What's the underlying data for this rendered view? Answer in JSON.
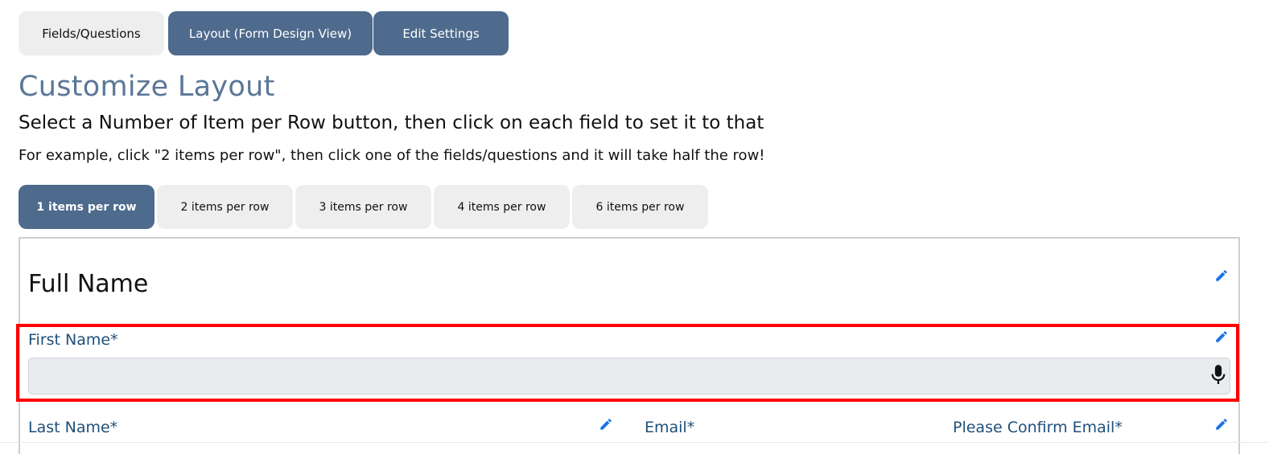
{
  "tabs": [
    {
      "label": "Fields/Questions",
      "active": false
    },
    {
      "label": "Layout (Form Design View)",
      "active": true
    },
    {
      "label": "Edit Settings",
      "active": false
    }
  ],
  "page": {
    "title": "Customize Layout",
    "subtitle": "Select a Number of Item per Row button, then click on each field to set it to that",
    "example": "For example, click \"2 items per row\", then click one of the fields/questions and it will take half the row!"
  },
  "row_options": [
    {
      "label": "1 items per row",
      "selected": true
    },
    {
      "label": "2 items per row",
      "selected": false
    },
    {
      "label": "3 items per row",
      "selected": false
    },
    {
      "label": "4 items per row",
      "selected": false
    },
    {
      "label": "6 items per row",
      "selected": false
    }
  ],
  "form": {
    "section_heading": "Full Name",
    "fields": {
      "first_name": {
        "label": "First Name*",
        "value": ""
      },
      "last_name": {
        "label": "Last Name*"
      },
      "email": {
        "label": "Email*"
      },
      "confirm_email": {
        "label": "Please Confirm Email*"
      }
    }
  },
  "colors": {
    "accent": "#4e6a8c",
    "title": "#5a7797",
    "label": "#1f4f7a",
    "edit_icon": "#1a73e8",
    "highlight": "#ff0000"
  },
  "icons": {
    "edit": "pencil-icon",
    "voice": "microphone-icon"
  }
}
